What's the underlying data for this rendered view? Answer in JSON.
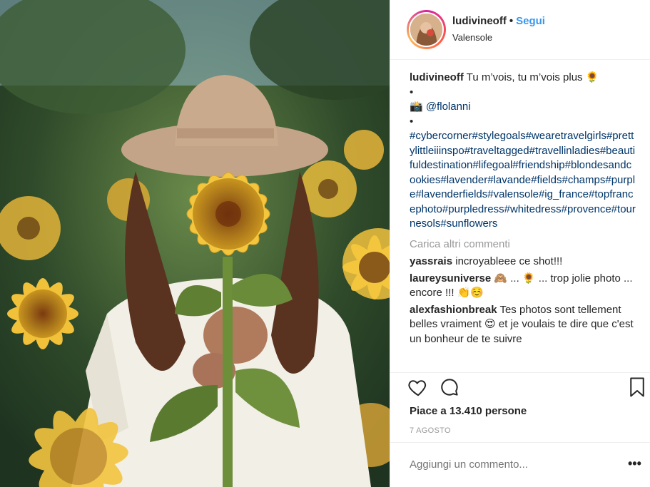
{
  "post": {
    "username": "ludivineoff",
    "separator": "•",
    "follow_label": "Segui",
    "location": "Valensole"
  },
  "caption": {
    "username": "ludivineoff",
    "text": "Tu m’vois, tu m’vois plus 🌻",
    "bullet1": "•",
    "photo_credit": "📸 @flolanni",
    "bullet2": "•",
    "hashtags": "#cybercorner#stylegoals#wearetravelgirls#prettylittleiiinspo#traveltagged#travellinladies#beautifuldestination#lifegoal#friendship#blondesandcookies#lavender#lavande#fields#champs#purple#lavenderfields#valensole#ig_france#topfrancephoto#purpledress#whitedress#provence#tournesols#sunflowers"
  },
  "load_more": "Carica altri commenti",
  "comments": [
    {
      "username": "yassrais",
      "text": "incroyableee ce shot!!!"
    },
    {
      "username": "laureysuniverse",
      "text": "🙈 ... 🌻 ... trop jolie photo ... encore !!! 👏☺️"
    },
    {
      "username": "alexfashionbreak",
      "text": "Tes photos sont tellement belles vraiment 😍 et je voulais te dire que c'est un bonheur de te suivre"
    }
  ],
  "icons": {
    "like": "heart-icon",
    "comment": "comment-bubble-icon",
    "save": "bookmark-icon",
    "more": "more-options-icon"
  },
  "likes": "Piace a 13.410 persone",
  "date": "7 AGOSTO",
  "add_comment_placeholder": "Aggiungi un commento...",
  "options_label": "•••",
  "colors": {
    "link": "#3897f0",
    "hashtag": "#003569",
    "muted": "#999999"
  }
}
